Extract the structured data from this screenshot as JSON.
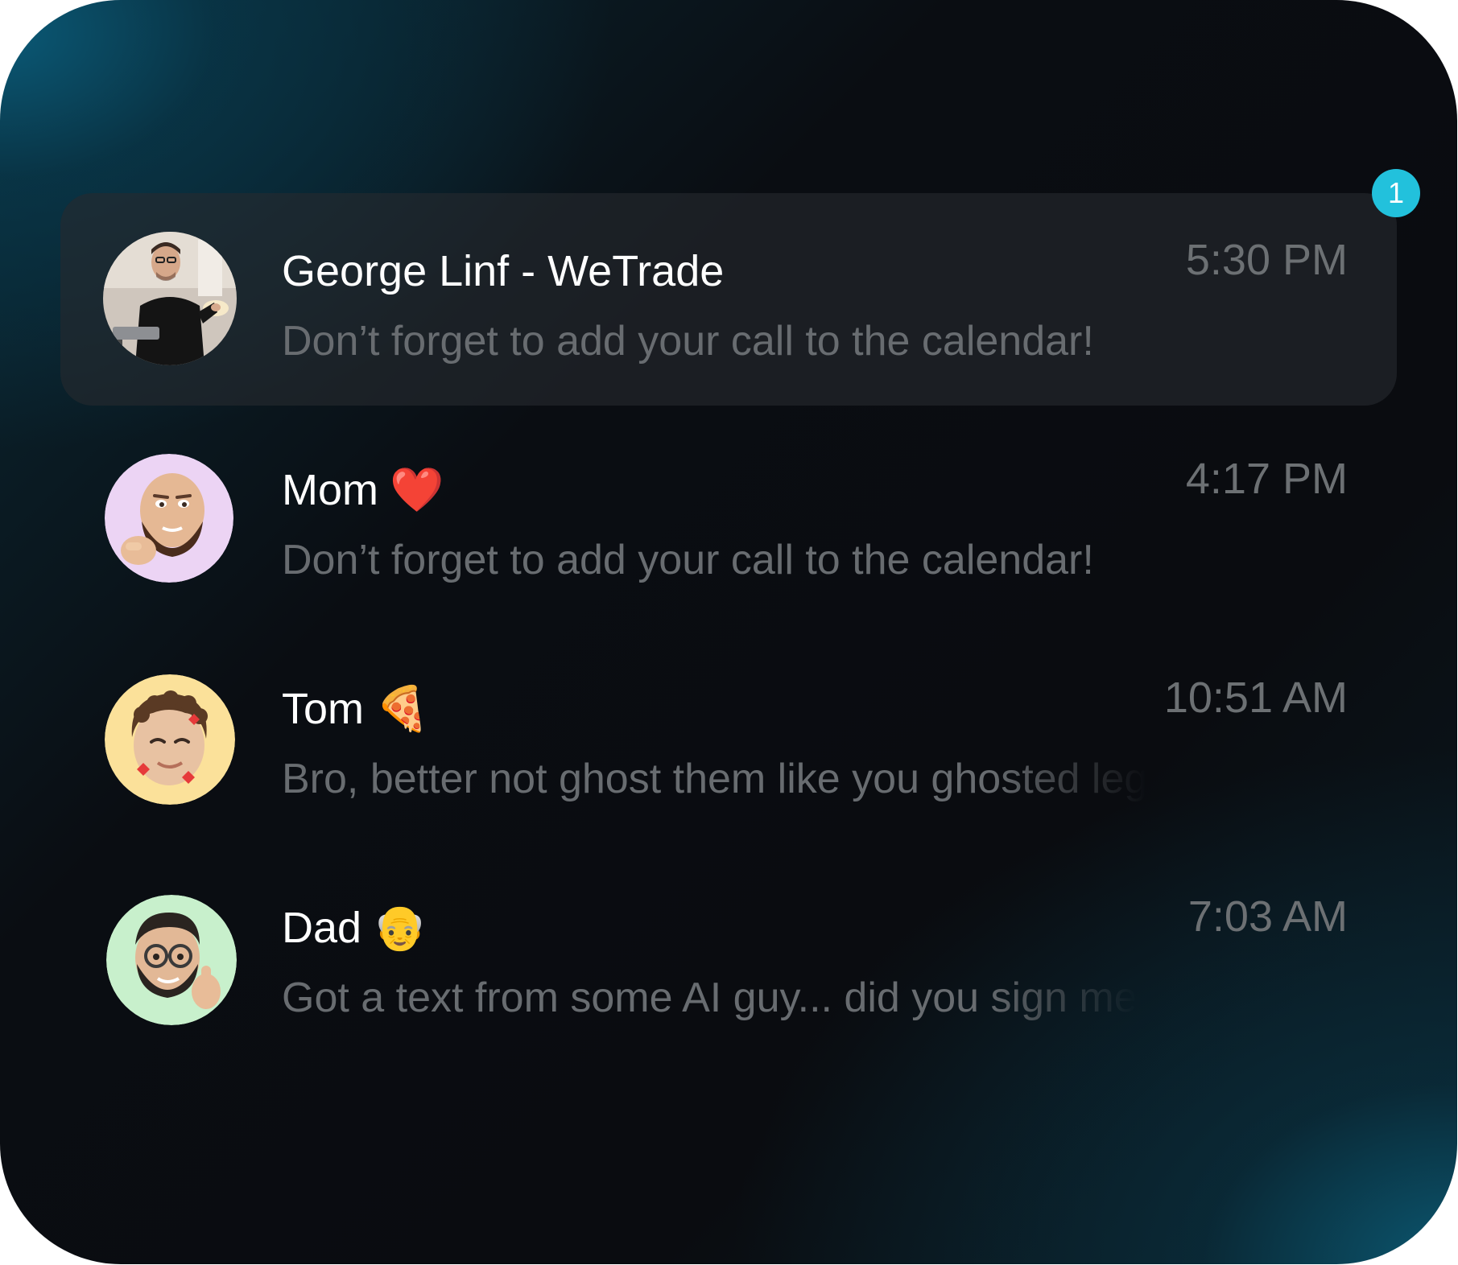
{
  "unread_badge": "1",
  "conversations": [
    {
      "name": "George Linf - WeTrade",
      "emoji": "",
      "time": "5:30 PM",
      "message": "Don’t forget to add your call to the calendar!",
      "avatar": "photo",
      "avatar_bg": "#cfc6bd",
      "highlighted": true
    },
    {
      "name": "Mom",
      "emoji": "❤️",
      "time": "4:17 PM",
      "message": "Don’t forget to add your call to the calendar!",
      "avatar": "memoji-bearded-man",
      "avatar_bg": "#ecd4f4",
      "highlighted": false
    },
    {
      "name": "Tom",
      "emoji": "🍕",
      "time": "10:51 AM",
      "message": "Bro, better not ghost them like you ghosted leg",
      "avatar": "memoji-curly-hair-hearts",
      "avatar_bg": "#fbe19a",
      "highlighted": false
    },
    {
      "name": "Dad",
      "emoji": "👴",
      "time": "7:03 AM",
      "message": "Got a text from some AI guy... did you sign me",
      "avatar": "memoji-glasses-thumbs-up",
      "avatar_bg": "#c8f0cc",
      "highlighted": false
    }
  ],
  "colors": {
    "accent_badge": "#22c1dc",
    "name_text": "#ffffff",
    "secondary_text": "#6c7073",
    "background": "#0a0c10",
    "teal_glow": "#0b5c7a"
  }
}
